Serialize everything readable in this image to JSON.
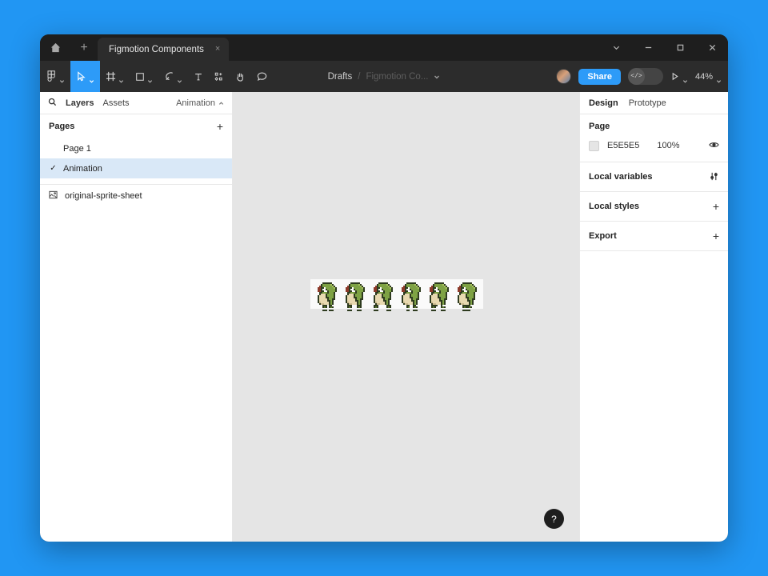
{
  "window": {
    "tab_title": "Figmotion Components",
    "home_icon": "home-icon",
    "new_tab_label": "+",
    "close_tab_label": "×",
    "controls": [
      "chevron-down-icon",
      "minimize-icon",
      "maximize-icon",
      "close-icon"
    ]
  },
  "toolbar": {
    "tools": [
      {
        "name": "figma-menu",
        "icon": "figma-logo-icon",
        "has_chevron": true,
        "active": false
      },
      {
        "name": "move-tool",
        "icon": "cursor-arrow-icon",
        "has_chevron": true,
        "active": true
      },
      {
        "name": "frame-tool",
        "icon": "frame-icon",
        "has_chevron": true,
        "active": false
      },
      {
        "name": "shape-tool",
        "icon": "rectangle-icon",
        "has_chevron": true,
        "active": false
      },
      {
        "name": "pen-tool",
        "icon": "pen-icon",
        "has_chevron": true,
        "active": false
      },
      {
        "name": "text-tool",
        "icon": "text-icon",
        "has_chevron": false,
        "active": false
      },
      {
        "name": "actions-tool",
        "icon": "components-plus-icon",
        "has_chevron": false,
        "active": false
      },
      {
        "name": "hand-tool",
        "icon": "hand-icon",
        "has_chevron": false,
        "active": false
      },
      {
        "name": "comment-tool",
        "icon": "comment-bubble-icon",
        "has_chevron": false,
        "active": false
      }
    ],
    "breadcrumb": {
      "root": "Drafts",
      "separator": "/",
      "file": "Figmotion Co...",
      "chevron": "chevron-down-icon"
    },
    "avatar": "user-avatar",
    "share_label": "Share",
    "dev_mode_icon": "code-brackets-icon",
    "present_icon": "play-icon",
    "zoom_level": "44%"
  },
  "left_panel": {
    "search_icon": "search-icon",
    "tabs": [
      {
        "label": "Layers",
        "active": true
      },
      {
        "label": "Assets",
        "active": false
      }
    ],
    "current_page_label": "Animation",
    "collapse_icon": "chevron-up-icon",
    "pages_title": "Pages",
    "add_page_label": "+",
    "pages": [
      {
        "label": "Page 1",
        "selected": false,
        "check": ""
      },
      {
        "label": "Animation",
        "selected": true,
        "check": "✓"
      }
    ],
    "layers": [
      {
        "label": "original-sprite-sheet",
        "icon": "image-layer-icon"
      }
    ]
  },
  "right_panel": {
    "tabs": [
      {
        "label": "Design",
        "active": true
      },
      {
        "label": "Prototype",
        "active": false
      }
    ],
    "page_section": {
      "title": "Page",
      "fill_hex": "E5E5E5",
      "fill_color": "#E5E5E5",
      "opacity": "100%",
      "visibility_icon": "eye-icon"
    },
    "rows": [
      {
        "title": "Local variables",
        "action_icon": "variables-sliders-icon",
        "action_label": ""
      },
      {
        "title": "Local styles",
        "action_icon": "plus-icon",
        "action_label": "+"
      },
      {
        "title": "Export",
        "action_icon": "plus-icon",
        "action_label": "+"
      }
    ]
  },
  "canvas": {
    "background_color": "#E5E5E5",
    "help_label": "?",
    "sprite_sheet": {
      "name": "original-sprite-sheet",
      "background_color": "#FAFAFA",
      "frame_count": 6,
      "colors": {
        "outline": "#2e3b1f",
        "body_dark": "#5d7a2e",
        "body_mid": "#7ea244",
        "body_light": "#a8c25e",
        "belly": "#e8d9b0",
        "belly_shadow": "#cdbb8e",
        "eye_white": "#ffffff",
        "accent_red": "#8d3a2a"
      }
    }
  }
}
